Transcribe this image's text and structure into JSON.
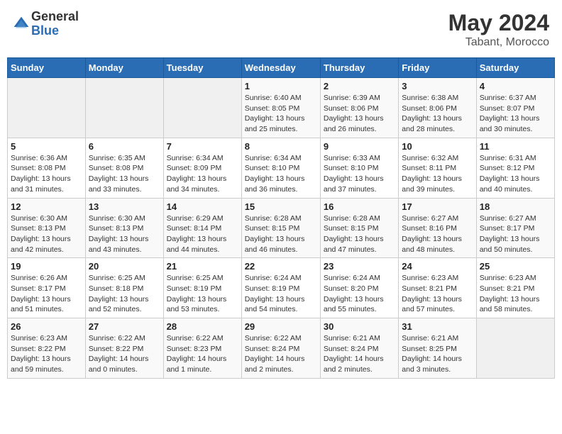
{
  "header": {
    "logo_general": "General",
    "logo_blue": "Blue",
    "month_year": "May 2024",
    "location": "Tabant, Morocco"
  },
  "weekdays": [
    "Sunday",
    "Monday",
    "Tuesday",
    "Wednesday",
    "Thursday",
    "Friday",
    "Saturday"
  ],
  "weeks": [
    [
      {
        "day": "",
        "sunrise": "",
        "sunset": "",
        "daylight": ""
      },
      {
        "day": "",
        "sunrise": "",
        "sunset": "",
        "daylight": ""
      },
      {
        "day": "",
        "sunrise": "",
        "sunset": "",
        "daylight": ""
      },
      {
        "day": "1",
        "sunrise": "Sunrise: 6:40 AM",
        "sunset": "Sunset: 8:05 PM",
        "daylight": "Daylight: 13 hours and 25 minutes."
      },
      {
        "day": "2",
        "sunrise": "Sunrise: 6:39 AM",
        "sunset": "Sunset: 8:06 PM",
        "daylight": "Daylight: 13 hours and 26 minutes."
      },
      {
        "day": "3",
        "sunrise": "Sunrise: 6:38 AM",
        "sunset": "Sunset: 8:06 PM",
        "daylight": "Daylight: 13 hours and 28 minutes."
      },
      {
        "day": "4",
        "sunrise": "Sunrise: 6:37 AM",
        "sunset": "Sunset: 8:07 PM",
        "daylight": "Daylight: 13 hours and 30 minutes."
      }
    ],
    [
      {
        "day": "5",
        "sunrise": "Sunrise: 6:36 AM",
        "sunset": "Sunset: 8:08 PM",
        "daylight": "Daylight: 13 hours and 31 minutes."
      },
      {
        "day": "6",
        "sunrise": "Sunrise: 6:35 AM",
        "sunset": "Sunset: 8:08 PM",
        "daylight": "Daylight: 13 hours and 33 minutes."
      },
      {
        "day": "7",
        "sunrise": "Sunrise: 6:34 AM",
        "sunset": "Sunset: 8:09 PM",
        "daylight": "Daylight: 13 hours and 34 minutes."
      },
      {
        "day": "8",
        "sunrise": "Sunrise: 6:34 AM",
        "sunset": "Sunset: 8:10 PM",
        "daylight": "Daylight: 13 hours and 36 minutes."
      },
      {
        "day": "9",
        "sunrise": "Sunrise: 6:33 AM",
        "sunset": "Sunset: 8:10 PM",
        "daylight": "Daylight: 13 hours and 37 minutes."
      },
      {
        "day": "10",
        "sunrise": "Sunrise: 6:32 AM",
        "sunset": "Sunset: 8:11 PM",
        "daylight": "Daylight: 13 hours and 39 minutes."
      },
      {
        "day": "11",
        "sunrise": "Sunrise: 6:31 AM",
        "sunset": "Sunset: 8:12 PM",
        "daylight": "Daylight: 13 hours and 40 minutes."
      }
    ],
    [
      {
        "day": "12",
        "sunrise": "Sunrise: 6:30 AM",
        "sunset": "Sunset: 8:13 PM",
        "daylight": "Daylight: 13 hours and 42 minutes."
      },
      {
        "day": "13",
        "sunrise": "Sunrise: 6:30 AM",
        "sunset": "Sunset: 8:13 PM",
        "daylight": "Daylight: 13 hours and 43 minutes."
      },
      {
        "day": "14",
        "sunrise": "Sunrise: 6:29 AM",
        "sunset": "Sunset: 8:14 PM",
        "daylight": "Daylight: 13 hours and 44 minutes."
      },
      {
        "day": "15",
        "sunrise": "Sunrise: 6:28 AM",
        "sunset": "Sunset: 8:15 PM",
        "daylight": "Daylight: 13 hours and 46 minutes."
      },
      {
        "day": "16",
        "sunrise": "Sunrise: 6:28 AM",
        "sunset": "Sunset: 8:15 PM",
        "daylight": "Daylight: 13 hours and 47 minutes."
      },
      {
        "day": "17",
        "sunrise": "Sunrise: 6:27 AM",
        "sunset": "Sunset: 8:16 PM",
        "daylight": "Daylight: 13 hours and 48 minutes."
      },
      {
        "day": "18",
        "sunrise": "Sunrise: 6:27 AM",
        "sunset": "Sunset: 8:17 PM",
        "daylight": "Daylight: 13 hours and 50 minutes."
      }
    ],
    [
      {
        "day": "19",
        "sunrise": "Sunrise: 6:26 AM",
        "sunset": "Sunset: 8:17 PM",
        "daylight": "Daylight: 13 hours and 51 minutes."
      },
      {
        "day": "20",
        "sunrise": "Sunrise: 6:25 AM",
        "sunset": "Sunset: 8:18 PM",
        "daylight": "Daylight: 13 hours and 52 minutes."
      },
      {
        "day": "21",
        "sunrise": "Sunrise: 6:25 AM",
        "sunset": "Sunset: 8:19 PM",
        "daylight": "Daylight: 13 hours and 53 minutes."
      },
      {
        "day": "22",
        "sunrise": "Sunrise: 6:24 AM",
        "sunset": "Sunset: 8:19 PM",
        "daylight": "Daylight: 13 hours and 54 minutes."
      },
      {
        "day": "23",
        "sunrise": "Sunrise: 6:24 AM",
        "sunset": "Sunset: 8:20 PM",
        "daylight": "Daylight: 13 hours and 55 minutes."
      },
      {
        "day": "24",
        "sunrise": "Sunrise: 6:23 AM",
        "sunset": "Sunset: 8:21 PM",
        "daylight": "Daylight: 13 hours and 57 minutes."
      },
      {
        "day": "25",
        "sunrise": "Sunrise: 6:23 AM",
        "sunset": "Sunset: 8:21 PM",
        "daylight": "Daylight: 13 hours and 58 minutes."
      }
    ],
    [
      {
        "day": "26",
        "sunrise": "Sunrise: 6:23 AM",
        "sunset": "Sunset: 8:22 PM",
        "daylight": "Daylight: 13 hours and 59 minutes."
      },
      {
        "day": "27",
        "sunrise": "Sunrise: 6:22 AM",
        "sunset": "Sunset: 8:22 PM",
        "daylight": "Daylight: 14 hours and 0 minutes."
      },
      {
        "day": "28",
        "sunrise": "Sunrise: 6:22 AM",
        "sunset": "Sunset: 8:23 PM",
        "daylight": "Daylight: 14 hours and 1 minute."
      },
      {
        "day": "29",
        "sunrise": "Sunrise: 6:22 AM",
        "sunset": "Sunset: 8:24 PM",
        "daylight": "Daylight: 14 hours and 2 minutes."
      },
      {
        "day": "30",
        "sunrise": "Sunrise: 6:21 AM",
        "sunset": "Sunset: 8:24 PM",
        "daylight": "Daylight: 14 hours and 2 minutes."
      },
      {
        "day": "31",
        "sunrise": "Sunrise: 6:21 AM",
        "sunset": "Sunset: 8:25 PM",
        "daylight": "Daylight: 14 hours and 3 minutes."
      },
      {
        "day": "",
        "sunrise": "",
        "sunset": "",
        "daylight": ""
      }
    ]
  ]
}
